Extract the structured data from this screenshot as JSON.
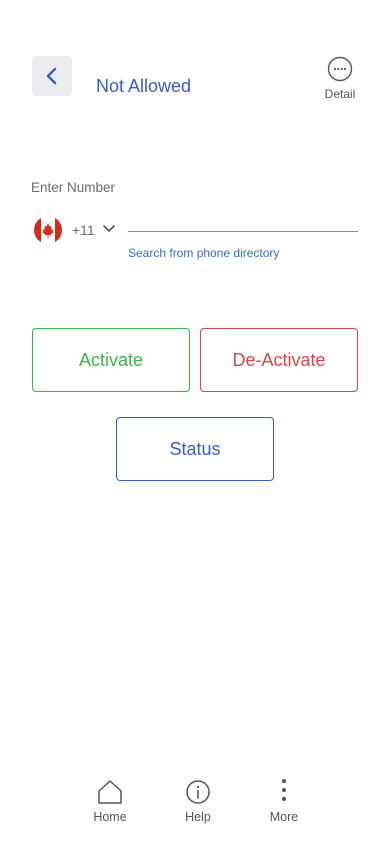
{
  "header": {
    "title": "Not Allowed",
    "back_icon": "chevron-left-icon",
    "detail_label": "Detail",
    "detail_icon": "more-horizontal-circle-icon"
  },
  "form": {
    "label": "Enter Number",
    "country_flag": "canada-flag-icon",
    "country_code": "+11",
    "phone_value": "",
    "directory_link": "Search from phone directory"
  },
  "actions": {
    "activate_label": "Activate",
    "deactivate_label": "De-Activate",
    "status_label": "Status"
  },
  "nav": {
    "items": [
      {
        "label": "Home",
        "icon": "home-icon"
      },
      {
        "label": "Help",
        "icon": "info-icon"
      },
      {
        "label": "More",
        "icon": "more-vertical-icon"
      }
    ]
  },
  "colors": {
    "accent": "#3a5bc7",
    "activate": "#39b54a",
    "deactivate": "#d9454f"
  }
}
